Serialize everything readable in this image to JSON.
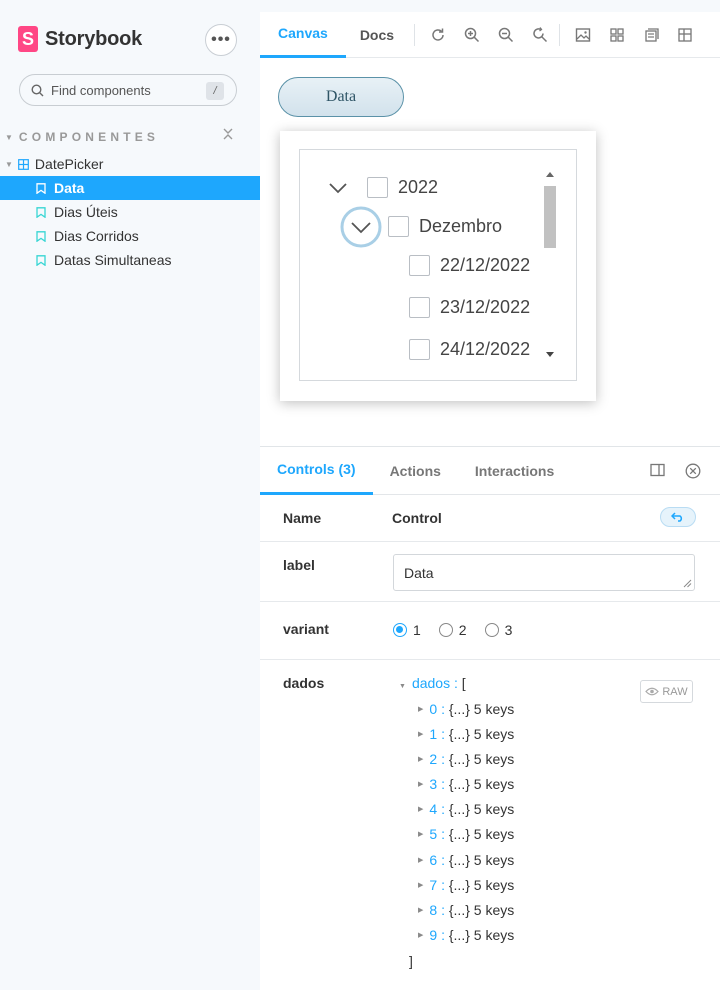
{
  "brand": {
    "name": "Storybook",
    "logo_letter": "S",
    "accent": "#ff4785"
  },
  "sidebar": {
    "search_placeholder": "Find components",
    "search_shortcut": "/",
    "section_title": "COMPONENTES",
    "group_label": "DatePicker",
    "stories": [
      {
        "label": "Data",
        "active": true
      },
      {
        "label": "Dias Úteis",
        "active": false
      },
      {
        "label": "Dias Corridos",
        "active": false
      },
      {
        "label": "Datas Simultaneas",
        "active": false
      }
    ]
  },
  "toolbar": {
    "tabs": [
      "Canvas",
      "Docs"
    ],
    "tools": [
      "reload-icon",
      "zoom-in-icon",
      "zoom-out-icon",
      "zoom-reset-icon",
      "background-icon",
      "grid-icon",
      "outline-icon",
      "viewport-icon"
    ]
  },
  "canvas": {
    "button_label": "Data",
    "tree": {
      "year": "2022",
      "month": "Dezembro",
      "days": [
        "22/12/2022",
        "23/12/2022",
        "24/12/2022"
      ]
    }
  },
  "addons": {
    "tabs": [
      "Controls (3)",
      "Actions",
      "Interactions"
    ],
    "header_name": "Name",
    "header_control": "Control",
    "controls": {
      "label": {
        "name": "label",
        "value": "Data"
      },
      "variant": {
        "name": "variant",
        "options": [
          "1",
          "2",
          "3"
        ],
        "selected": "1"
      },
      "dados": {
        "name": "dados",
        "root_key": "dados",
        "root_open": "[",
        "root_close": "]",
        "raw_label": "RAW",
        "items": [
          {
            "key": "0",
            "summary": "{...}",
            "count": "5 keys"
          },
          {
            "key": "1",
            "summary": "{...}",
            "count": "5 keys"
          },
          {
            "key": "2",
            "summary": "{...}",
            "count": "5 keys"
          },
          {
            "key": "3",
            "summary": "{...}",
            "count": "5 keys"
          },
          {
            "key": "4",
            "summary": "{...}",
            "count": "5 keys"
          },
          {
            "key": "5",
            "summary": "{...}",
            "count": "5 keys"
          },
          {
            "key": "6",
            "summary": "{...}",
            "count": "5 keys"
          },
          {
            "key": "7",
            "summary": "{...}",
            "count": "5 keys"
          },
          {
            "key": "8",
            "summary": "{...}",
            "count": "5 keys"
          },
          {
            "key": "9",
            "summary": "{...}",
            "count": "5 keys"
          }
        ]
      }
    }
  },
  "colors": {
    "accent_blue": "#1ea7fd",
    "sidebar_bg": "#f6f9fc"
  }
}
